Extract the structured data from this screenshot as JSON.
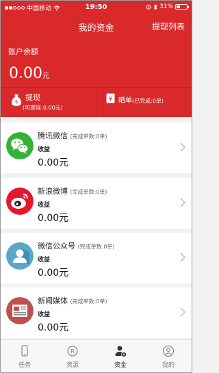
{
  "status_bar": {
    "carrier": "中国移动",
    "time": "19:50",
    "battery": "31%"
  },
  "nav": {
    "title": "我的资金",
    "action": "提现列表"
  },
  "balance": {
    "label": "账户余额",
    "amount": "0.00",
    "unit": "元"
  },
  "withdraw": {
    "title": "提现",
    "subtitle": "(可提现:0.00元)"
  },
  "showoff": {
    "title": "晒单",
    "subtitle": "(已完成:0单)"
  },
  "channels": [
    {
      "name": "腾讯微信",
      "orders": "(完成单数:0单)",
      "income_label": "收益",
      "income_value": "0.00元"
    },
    {
      "name": "新浪微博",
      "orders": "(完成单数:0单)",
      "income_label": "收益",
      "income_value": "0.00元"
    },
    {
      "name": "微信公众号",
      "orders": "(完成单数:0单)",
      "income_label": "收益",
      "income_value": "0.00元"
    },
    {
      "name": "新闻媒体",
      "orders": "(完成单数:0单)",
      "income_label": "收益",
      "income_value": "0.00元"
    }
  ],
  "tabs": [
    {
      "label": "任务",
      "icon": "phone-icon"
    },
    {
      "label": "资源",
      "icon": "registered-icon"
    },
    {
      "label": "资金",
      "icon": "person-money-icon",
      "active": true
    },
    {
      "label": "我的",
      "icon": "user-icon"
    }
  ],
  "colors": {
    "primary": "#d9292a",
    "wechat": "#35b235",
    "weibo": "#e6162d",
    "official": "#5aa8c8",
    "news": "#c0504d"
  }
}
